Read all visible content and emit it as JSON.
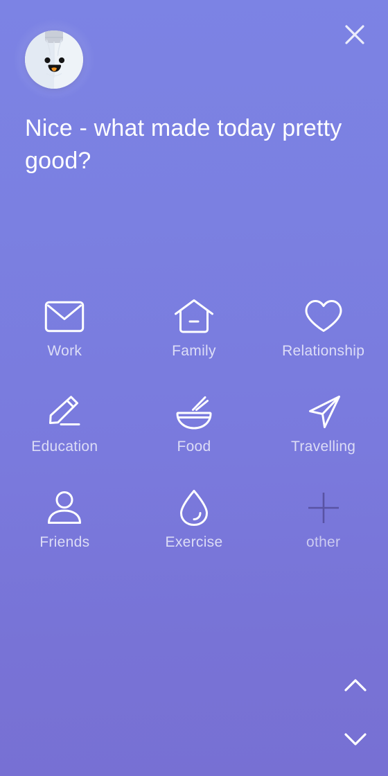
{
  "screen": {
    "name": "mood-reason-picker",
    "background_top": "#7c83e4",
    "background_bottom": "#7770d3"
  },
  "header": {
    "avatar_name": "mascot-avatar",
    "avatar_colors": {
      "face": "#eef3f8",
      "cap": "#c9ced8",
      "eye": "#151515",
      "mouth": "#151515",
      "tongue": "#f0921f"
    },
    "close_label": "×",
    "close_icon": "close-icon",
    "title": "Nice - what made today pretty good?"
  },
  "grid": {
    "items": [
      {
        "label": "Work",
        "icon": "envelope-icon",
        "muted": false
      },
      {
        "label": "Family",
        "icon": "house-icon",
        "muted": false
      },
      {
        "label": "Relationship",
        "icon": "heart-icon",
        "muted": false
      },
      {
        "label": "Education",
        "icon": "pencil-icon",
        "muted": false
      },
      {
        "label": "Food",
        "icon": "bowl-icon",
        "muted": false
      },
      {
        "label": "Travelling",
        "icon": "send-arrow-icon",
        "muted": false
      },
      {
        "label": "Friends",
        "icon": "person-icon",
        "muted": false
      },
      {
        "label": "Exercise",
        "icon": "droplet-icon",
        "muted": false
      },
      {
        "label": "other",
        "icon": "plus-icon",
        "muted": true
      }
    ]
  },
  "bottom_nav": {
    "up_icon": "chevron-up-icon",
    "down_icon": "chevron-down-icon"
  }
}
